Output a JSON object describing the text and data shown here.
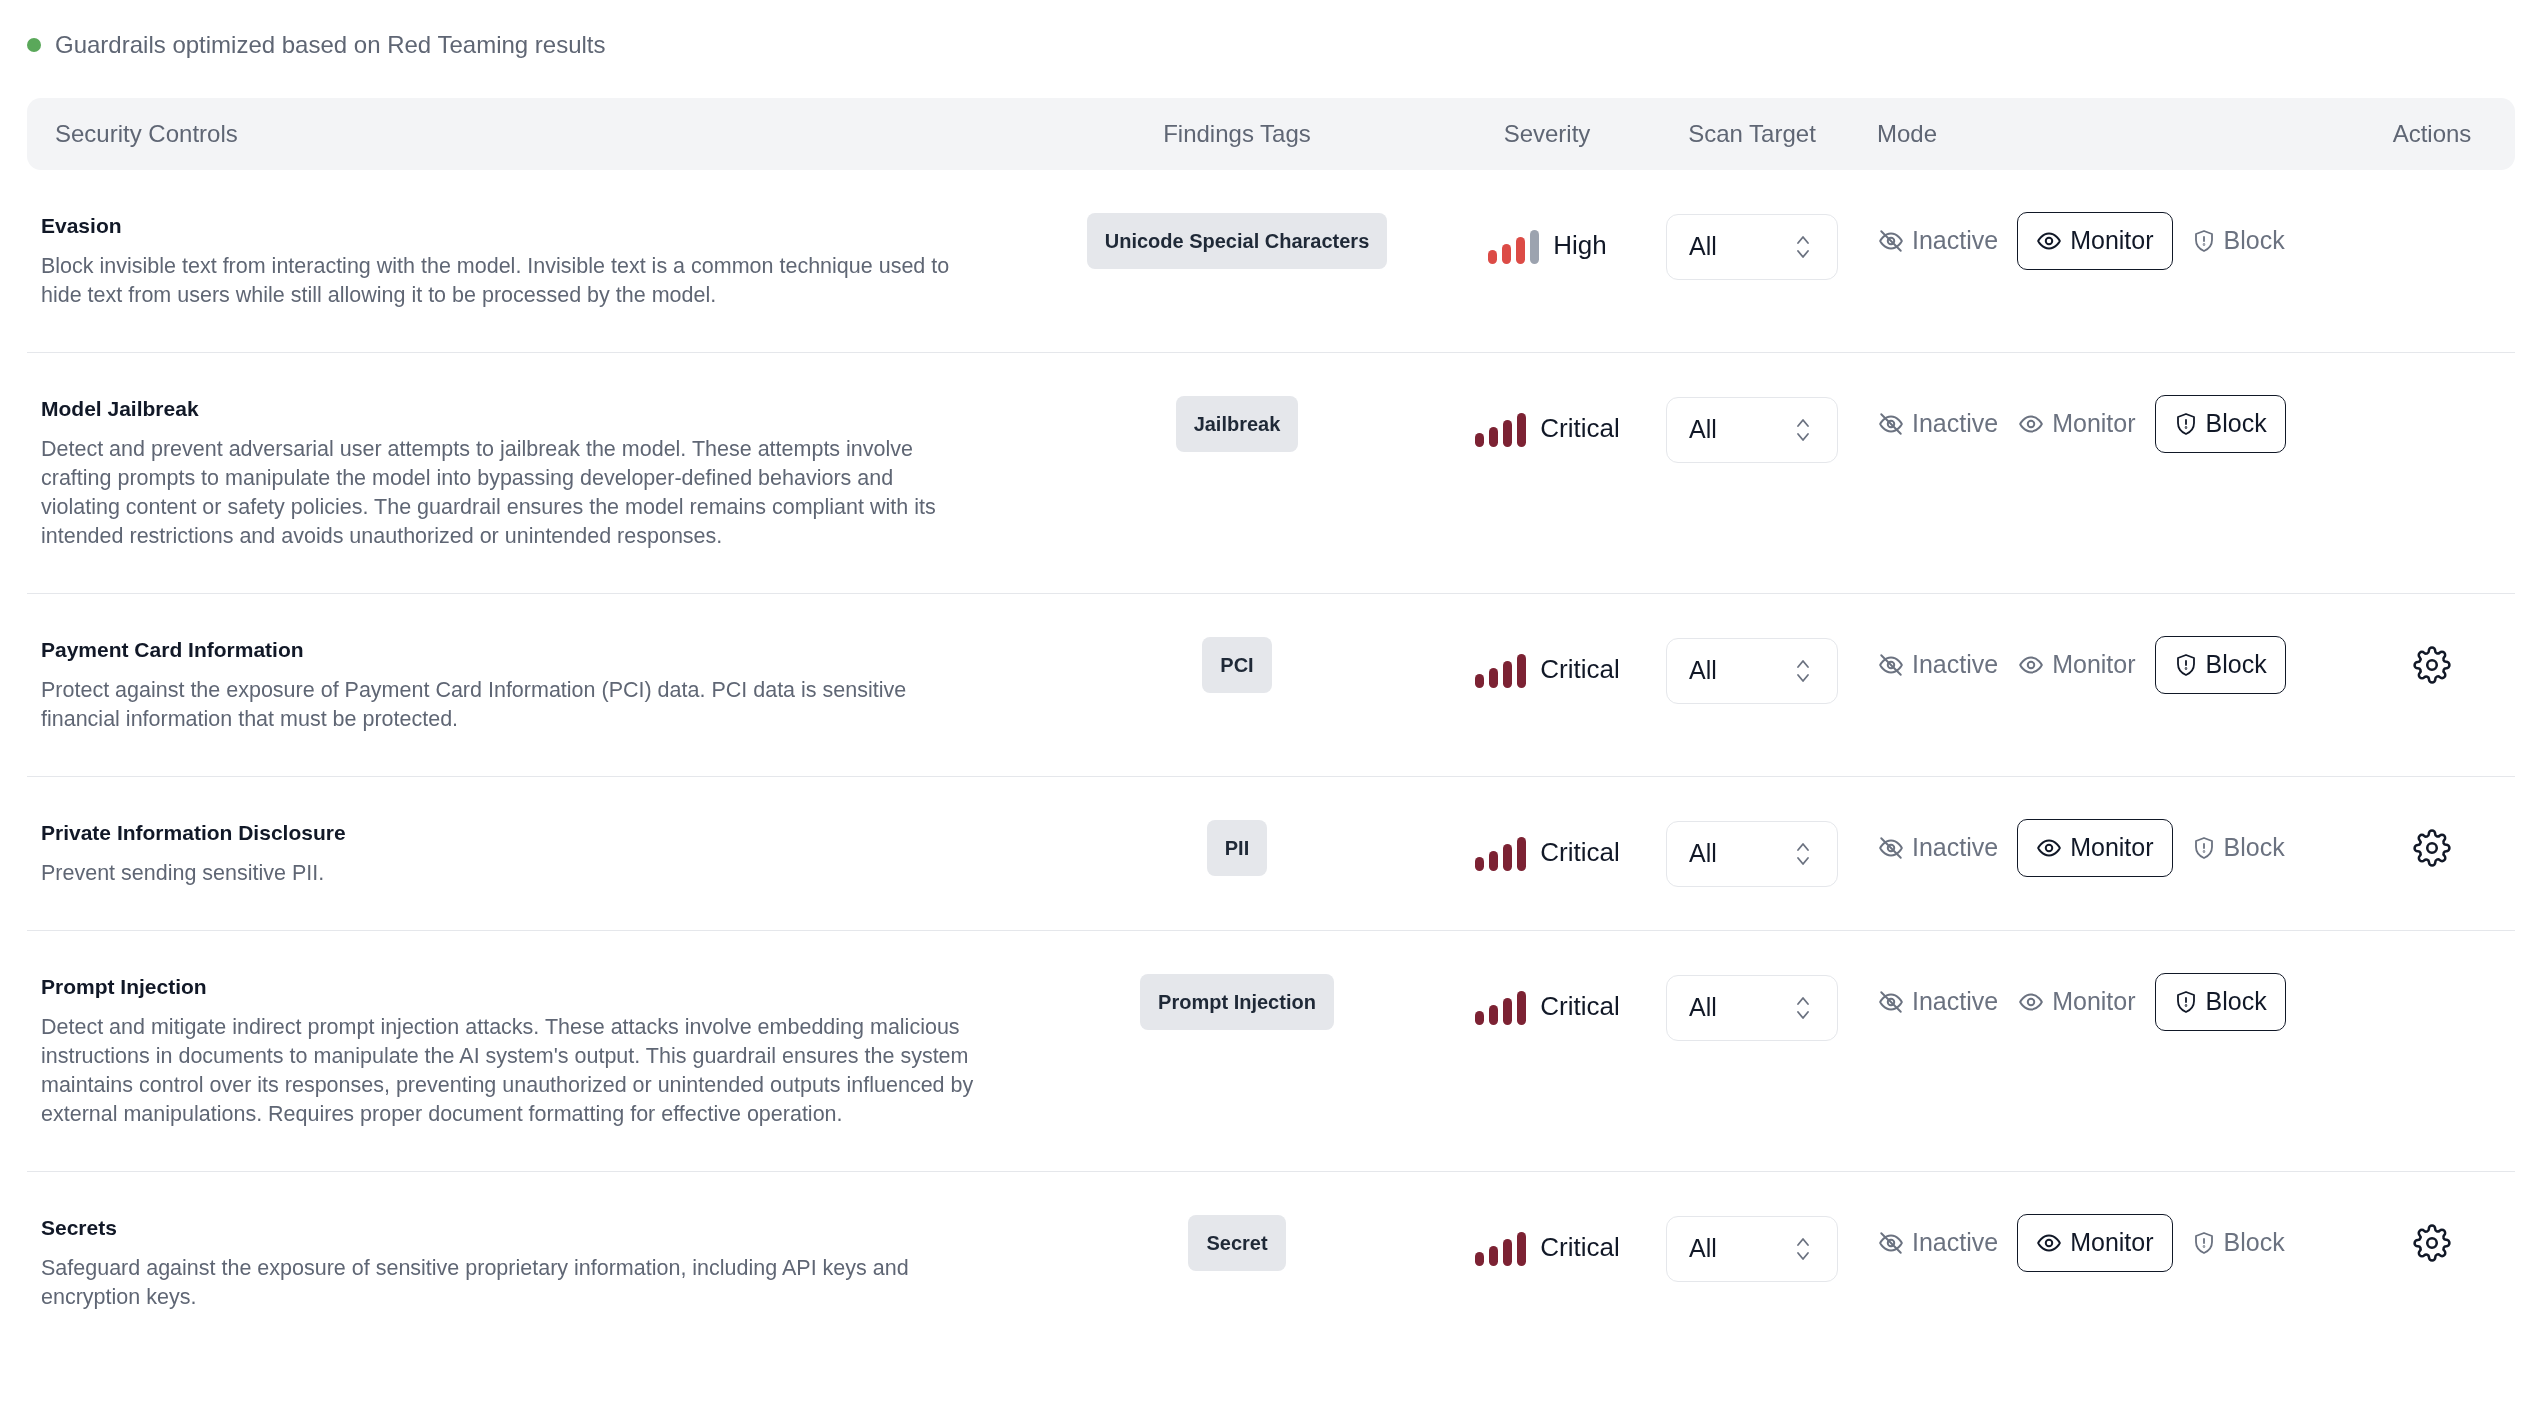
{
  "status": {
    "text": "Guardrails optimized based on Red Teaming results",
    "color": "#5aa85a"
  },
  "table": {
    "columns": [
      "Security Controls",
      "Findings Tags",
      "Severity",
      "Scan Target",
      "Mode",
      "Actions"
    ],
    "rows": [
      {
        "title": "Evasion",
        "description": "Block invisible text from interacting with the model. Invisible text is a common technique used to hide text from users while still allowing it to be processed by the model.",
        "tag": "Unicode Special Characters",
        "severity": {
          "kind": "high",
          "label": "High"
        },
        "scan_target": "All",
        "modes": [
          {
            "kind": "inactive",
            "label": "Inactive",
            "selected": false
          },
          {
            "kind": "monitor",
            "label": "Monitor",
            "selected": true
          },
          {
            "kind": "block",
            "label": "Block",
            "selected": false
          }
        ],
        "settings": false
      },
      {
        "title": "Model Jailbreak",
        "description": "Detect and prevent adversarial user attempts to jailbreak the model. These attempts involve crafting prompts to manipulate the model into bypassing developer-defined behaviors and violating content or safety policies. The guardrail ensures the model remains compliant with its intended restrictions and avoids unauthorized or unintended responses.",
        "tag": "Jailbreak",
        "severity": {
          "kind": "critical",
          "label": "Critical"
        },
        "scan_target": "All",
        "modes": [
          {
            "kind": "inactive",
            "label": "Inactive",
            "selected": false
          },
          {
            "kind": "monitor",
            "label": "Monitor",
            "selected": false
          },
          {
            "kind": "block",
            "label": "Block",
            "selected": true
          }
        ],
        "settings": false
      },
      {
        "title": "Payment Card Information",
        "description": "Protect against the exposure of Payment Card Information (PCI) data. PCI data is sensitive financial information that must be protected.",
        "tag": "PCI",
        "severity": {
          "kind": "critical",
          "label": "Critical"
        },
        "scan_target": "All",
        "modes": [
          {
            "kind": "inactive",
            "label": "Inactive",
            "selected": false
          },
          {
            "kind": "monitor",
            "label": "Monitor",
            "selected": false
          },
          {
            "kind": "block",
            "label": "Block",
            "selected": true
          }
        ],
        "settings": true
      },
      {
        "title": "Private Information Disclosure",
        "description": "Prevent sending sensitive PII.",
        "tag": "PII",
        "severity": {
          "kind": "critical",
          "label": "Critical"
        },
        "scan_target": "All",
        "modes": [
          {
            "kind": "inactive",
            "label": "Inactive",
            "selected": false
          },
          {
            "kind": "monitor",
            "label": "Monitor",
            "selected": true
          },
          {
            "kind": "block",
            "label": "Block",
            "selected": false
          }
        ],
        "settings": true
      },
      {
        "title": "Prompt Injection",
        "description": "Detect and mitigate indirect prompt injection attacks. These attacks involve embedding malicious instructions in documents to manipulate the AI system's output. This guardrail ensures the system maintains control over its responses, preventing unauthorized or unintended outputs influenced by external manipulations. Requires proper document formatting for effective operation.",
        "tag": "Prompt Injection",
        "severity": {
          "kind": "critical",
          "label": "Critical"
        },
        "scan_target": "All",
        "modes": [
          {
            "kind": "inactive",
            "label": "Inactive",
            "selected": false
          },
          {
            "kind": "monitor",
            "label": "Monitor",
            "selected": false
          },
          {
            "kind": "block",
            "label": "Block",
            "selected": true
          }
        ],
        "settings": false
      },
      {
        "title": "Secrets",
        "description": "Safeguard against the exposure of sensitive proprietary information, including API keys and encryption keys.",
        "tag": "Secret",
        "severity": {
          "kind": "critical",
          "label": "Critical"
        },
        "scan_target": "All",
        "modes": [
          {
            "kind": "inactive",
            "label": "Inactive",
            "selected": false
          },
          {
            "kind": "monitor",
            "label": "Monitor",
            "selected": true
          },
          {
            "kind": "block",
            "label": "Block",
            "selected": false
          }
        ],
        "settings": true
      }
    ]
  }
}
